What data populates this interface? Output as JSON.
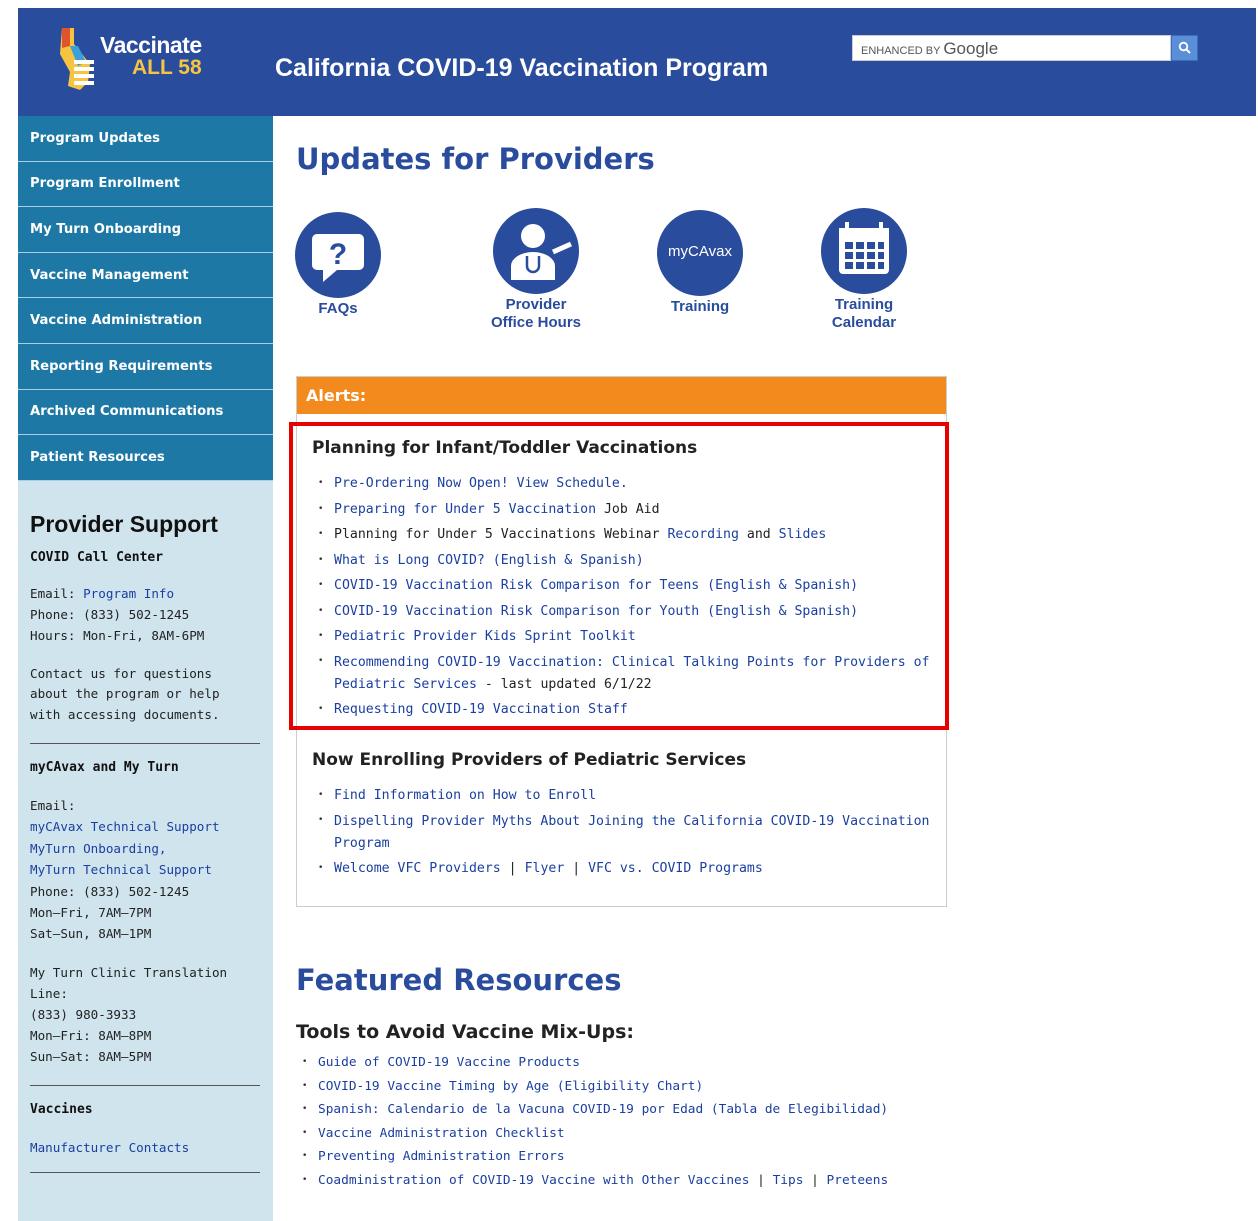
{
  "header": {
    "logo_line1": "Vaccinate",
    "logo_line2": "ALL 58",
    "site_title": "California COVID-19 Vaccination Program",
    "search_prefix": "ENHANCED BY",
    "search_brand": "Google"
  },
  "sidebar": {
    "nav": [
      {
        "label": "Program Updates"
      },
      {
        "label": "Program Enrollment"
      },
      {
        "label": "My Turn Onboarding"
      },
      {
        "label": "Vaccine Management"
      },
      {
        "label": "Vaccine Administration"
      },
      {
        "label": "Reporting Requirements"
      },
      {
        "label": "Archived Communications"
      },
      {
        "label": "Patient Resources"
      }
    ],
    "support_title": "Provider Support",
    "call_center_title": "COVID Call Center",
    "call_center_email_label": "Email:",
    "call_center_email_link": "Program Info",
    "call_center_phone": "Phone: (833) 502-1245",
    "call_center_hours": "Hours: Mon-Fri, 8AM-6PM",
    "contact_note": "Contact us for questions about the program or help with accessing documents.",
    "mycavax_title": "myCAvax and My Turn",
    "mycavax_email_label": "Email:",
    "mycavax_link1": "myCAvax Technical Support",
    "mycavax_link2": "MyTurn Onboarding,",
    "mycavax_link3": "MyTurn Technical Support",
    "mycavax_phone": "Phone: (833) 502-1245",
    "mycavax_hours1": "Mon–Fri, 7AM–7PM",
    "mycavax_hours2": "Sat–Sun, 8AM–1PM",
    "translation_label": "My Turn Clinic Translation Line:",
    "translation_phone": "(833) 980-3933",
    "translation_hours1": "Mon–Fri: 8AM–8PM",
    "translation_hours2": "Sun–Sat: 8AM–5PM",
    "vaccines_title": "Vaccines",
    "vaccines_link": "Manufacturer Contacts"
  },
  "main": {
    "title": "Updates for Providers",
    "icons": [
      {
        "label": "FAQs"
      },
      {
        "label": "Provider Office Hours"
      },
      {
        "label": "Training",
        "badge": "myCAvax"
      },
      {
        "label": "Training Calendar"
      }
    ],
    "alerts_label": "Alerts:",
    "section1": {
      "title": "Planning for Infant/Toddler Vaccinations",
      "items": [
        {
          "link": "Pre-Ordering Now Open! View Schedule.",
          "rest": ""
        },
        {
          "link": "Preparing for Under 5 Vaccination",
          "rest": " Job Aid"
        },
        {
          "pre": "Planning for Under 5 Vaccinations Webinar ",
          "link": "Recording",
          "mid": " and ",
          "link2": "Slides"
        },
        {
          "link": "What is Long COVID? (English & Spanish)",
          "rest": ""
        },
        {
          "link": "COVID-19 Vaccination Risk Comparison for Teens (English & Spanish)",
          "rest": ""
        },
        {
          "link": "COVID-19 Vaccination Risk Comparison for Youth (English & Spanish)",
          "rest": ""
        },
        {
          "link": "Pediatric Provider Kids Sprint Toolkit",
          "rest": ""
        },
        {
          "link": "Recommending COVID-19 Vaccination: Clinical Talking Points for Providers of Pediatric Services",
          "rest": " - last updated 6/1/22"
        },
        {
          "link": "Requesting COVID-19 Vaccination Staff",
          "rest": ""
        }
      ]
    },
    "section2": {
      "title": "Now Enrolling Providers of Pediatric Services",
      "items": [
        {
          "link": "Find Information on How to Enroll"
        },
        {
          "link": "Dispelling Provider Myths About Joining the California COVID-19 Vaccination Program"
        },
        {
          "link": "Welcome VFC Providers",
          "sep1": " | ",
          "link2": "Flyer",
          "sep2": " | ",
          "link3": "VFC vs. COVID Programs"
        }
      ]
    },
    "featured_title": "Featured Resources",
    "mixups_title": "Tools to Avoid Vaccine Mix-Ups:",
    "mixups": [
      {
        "link": "Guide of COVID-19 Vaccine Products"
      },
      {
        "link": "COVID-19 Vaccine Timing by Age (Eligibility Chart)"
      },
      {
        "link": "Spanish: Calendario de la Vacuna COVID-19 por Edad (Tabla de Elegibilidad)"
      },
      {
        "link": "Vaccine Administration Checklist"
      },
      {
        "link": "Preventing Administration Errors"
      },
      {
        "link": "Coadministration of COVID-19 Vaccine with Other Vaccines",
        "sep1": " | ",
        "link2": "Tips",
        "sep2": " | ",
        "link3": "Preteens"
      }
    ]
  },
  "colors": {
    "header_blue": "#2a4c9c",
    "nav_teal": "#1e78a6",
    "sidebar_bg": "#d0e4ee",
    "alerts_orange": "#f28a1e",
    "highlight_red": "#e60000",
    "logo_gold": "#f6c440"
  }
}
